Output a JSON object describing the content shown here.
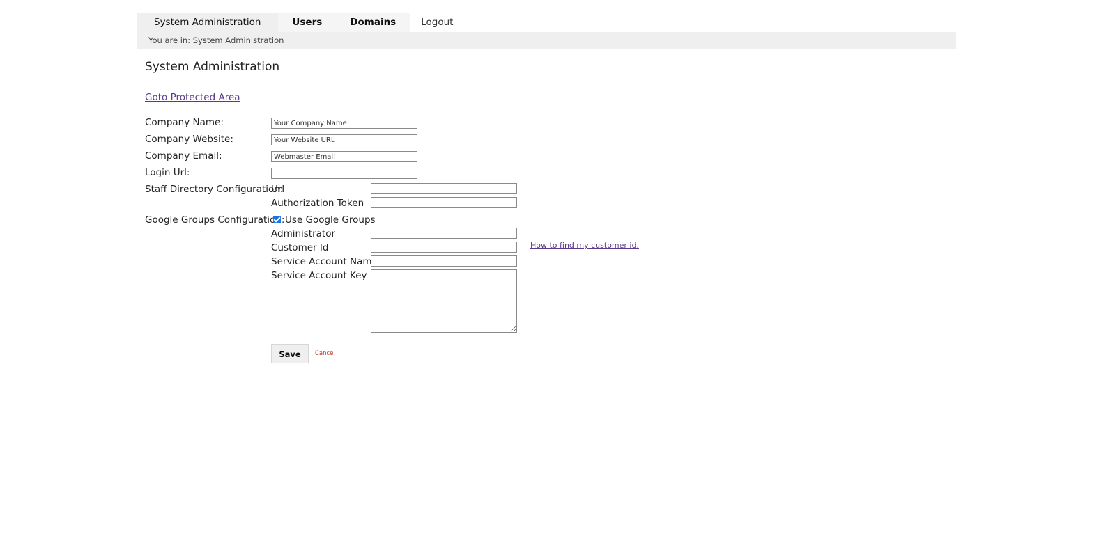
{
  "nav": {
    "tabs": [
      {
        "label": "System Administration"
      },
      {
        "label": "Users"
      },
      {
        "label": "Domains"
      },
      {
        "label": "Logout"
      }
    ],
    "breadcrumb": "You are in: System Administration"
  },
  "page": {
    "title": "System Administration",
    "goto_link": "Goto Protected Area"
  },
  "form": {
    "company_name": {
      "label": "Company Name:",
      "value": "Your Company Name"
    },
    "company_website": {
      "label": "Company Website:",
      "value": "Your Website URL"
    },
    "company_email": {
      "label": "Company Email:",
      "value": "Webmaster Email"
    },
    "login_url": {
      "label": "Login Url:",
      "value": ""
    },
    "staff_directory": {
      "label": "Staff Directory Configuration:",
      "url_label": "Url",
      "url_value": "",
      "token_label": "Authorization Token",
      "token_value": ""
    },
    "google_groups": {
      "label": "Google Groups Configuration:",
      "use_label": "Use Google Groups",
      "use_checked": true,
      "admin_label": "Administrator",
      "admin_value": "",
      "customer_id_label": "Customer Id",
      "customer_id_value": "",
      "customer_id_help": "How to find my customer id.",
      "service_account_name_label": "Service Account Name",
      "service_account_name_value": "",
      "service_account_key_label": "Service Account Key",
      "service_account_key_value": ""
    },
    "save_label": "Save",
    "cancel_label": "Cancel"
  },
  "colors": {
    "tab_bg": "#efefef",
    "link": "#5a3a8a",
    "cancel": "#c0392b",
    "checkbox": "#1a73e8"
  }
}
